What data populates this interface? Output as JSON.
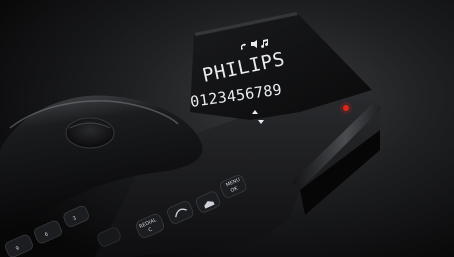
{
  "product": {
    "display": {
      "brand_line": "PHILIPS",
      "number_line": "0123456789",
      "status_icons": [
        "handset-icon",
        "speaker-icon",
        "music-icon"
      ]
    },
    "keys": {
      "menu_ok": "MENU OK",
      "redial_c": "REDIAL C",
      "key_3": "3",
      "key_6": "6",
      "key_9": "9"
    },
    "indicator_light_color": "#e0241b"
  }
}
